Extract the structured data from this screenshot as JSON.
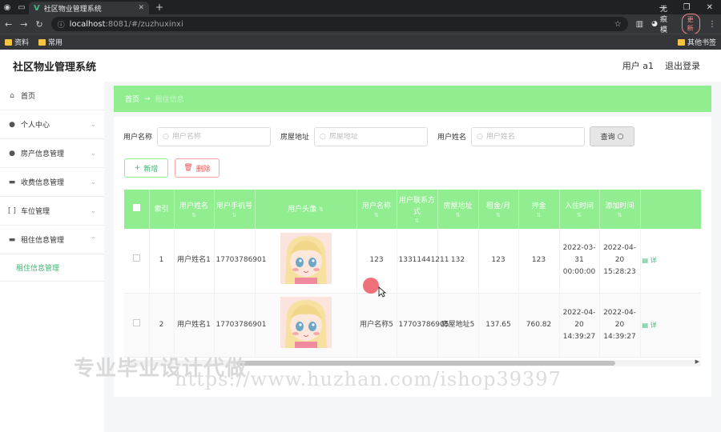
{
  "browser": {
    "tab_title": "社区物业管理系统",
    "url_host": "localhost",
    "url_rest": ":8081/#/zuzhuxinxi",
    "incognito_label": "无痕模式",
    "update_label": "更新",
    "bookmarks": [
      "资料",
      "常用"
    ],
    "bookmarks_right": "其他书签"
  },
  "header": {
    "title": "社区物业管理系统",
    "user_label": "用户 a1",
    "logout_label": "退出登录"
  },
  "sidebar": {
    "items": [
      {
        "icon": "home-icon",
        "label": "首页"
      },
      {
        "icon": "user-icon",
        "label": "个人中心"
      },
      {
        "icon": "user-icon",
        "label": "房产信息管理"
      },
      {
        "icon": "monitor-icon",
        "label": "收费信息管理"
      },
      {
        "icon": "bracket-icon",
        "label": "车位管理"
      },
      {
        "icon": "monitor-icon",
        "label": "租住信息管理"
      }
    ],
    "sub_item": "租住信息管理"
  },
  "breadcrumb": {
    "home": "首页",
    "arrow": "→",
    "current": "租住信息"
  },
  "search": {
    "fields": [
      {
        "label": "用户名称",
        "placeholder": "用户名称"
      },
      {
        "label": "房屋地址",
        "placeholder": "房屋地址"
      },
      {
        "label": "用户姓名",
        "placeholder": "用户姓名"
      }
    ],
    "query_label": "查询"
  },
  "actions": {
    "add_label": "新增",
    "delete_label": "删除"
  },
  "table": {
    "headers": [
      "索引",
      "用户姓名",
      "用户手机号",
      "用户头像",
      "用户名称",
      "用户联系方式",
      "房屋地址",
      "租金/月",
      "押金",
      "入住时间",
      "添加时间"
    ],
    "rows": [
      {
        "index": "1",
        "name": "用户姓名1",
        "phone": "17703786901",
        "username": "123",
        "contact": "13311441211",
        "address": "132",
        "rent": "123",
        "deposit": "123",
        "checkin": "2022-03-31 00:00:00",
        "added": "2022-04-20 15:28:23",
        "detail": "详"
      },
      {
        "index": "2",
        "name": "用户姓名1",
        "phone": "17703786901",
        "username": "用户名称5",
        "contact": "17703786905",
        "address": "房屋地址5",
        "rent": "137.65",
        "deposit": "760.82",
        "checkin": "2022-04-20 14:39:27",
        "added": "2022-04-20 14:39:27",
        "detail": "详"
      }
    ]
  },
  "watermark": {
    "line1": "专业毕业设计代做",
    "line2": "https://www.huzhan.com/ishop39397"
  }
}
